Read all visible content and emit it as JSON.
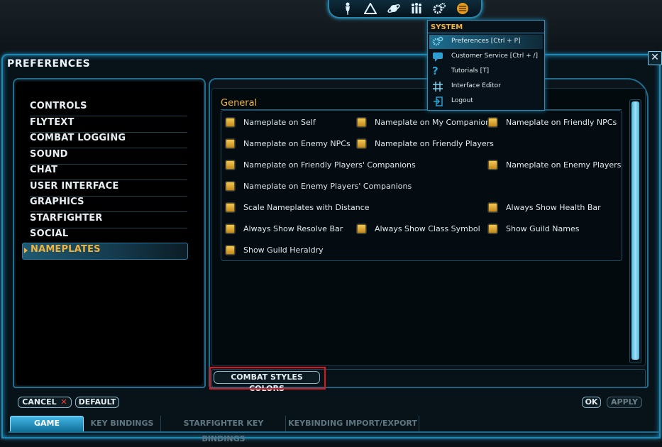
{
  "window": {
    "title": "PREFERENCES",
    "close_label": "✕"
  },
  "topbar": {
    "icons": [
      "character-icon",
      "abilities-icon",
      "galaxy-map-icon",
      "social-icon",
      "system-gear-icon",
      "credits-icon"
    ]
  },
  "system_menu": {
    "header": "SYSTEM",
    "items": [
      {
        "label": "Preferences [Ctrl + P]",
        "icon": "gear-icon"
      },
      {
        "label": "Customer Service [Ctrl + /]",
        "icon": "chat-bubble-icon"
      },
      {
        "label": "Tutorials [T]",
        "icon": "question-icon"
      },
      {
        "label": "Interface Editor",
        "icon": "grid-icon"
      },
      {
        "label": "Logout",
        "icon": "logout-icon"
      }
    ]
  },
  "sidebar": {
    "items": [
      {
        "label": "CONTROLS"
      },
      {
        "label": "FLYTEXT"
      },
      {
        "label": "COMBAT LOGGING"
      },
      {
        "label": "SOUND"
      },
      {
        "label": "CHAT"
      },
      {
        "label": "USER INTERFACE"
      },
      {
        "label": "GRAPHICS"
      },
      {
        "label": "STARFIGHTER"
      },
      {
        "label": "SOCIAL"
      },
      {
        "label": "NAMEPLATES"
      }
    ],
    "active": "NAMEPLATES"
  },
  "general": {
    "title": "General",
    "options": [
      {
        "label": "Nameplate on Self",
        "checked": true
      },
      {
        "label": "Nameplate on My Companion",
        "checked": true
      },
      {
        "label": "Nameplate on Friendly NPCs",
        "checked": true
      },
      {
        "label": "Nameplate on Enemy NPCs",
        "checked": true
      },
      {
        "label": "Nameplate on Friendly Players",
        "checked": true
      },
      {
        "label": "Nameplate on Friendly Players' Companions",
        "checked": true
      },
      {
        "label": "Nameplate on Enemy Players",
        "checked": true
      },
      {
        "label": "Nameplate on Enemy Players' Companions",
        "checked": true
      },
      {
        "label": "Scale Nameplates with Distance",
        "checked": true
      },
      {
        "label": "Always Show Health Bar",
        "checked": true
      },
      {
        "label": "Always Show Resolve Bar",
        "checked": true
      },
      {
        "label": "Always Show Class Symbol",
        "checked": true
      },
      {
        "label": "Show Guild Names",
        "checked": true
      },
      {
        "label": "Show Guild Heraldry",
        "checked": true
      }
    ]
  },
  "buttons": {
    "combat_styles_colors": "COMBAT STYLES COLORS",
    "cancel": "CANCEL",
    "cancel_icon": "✕",
    "default": "DEFAULT",
    "ok": "OK",
    "apply": "APPLY"
  },
  "tabs": [
    {
      "label": "GAME",
      "active": true
    },
    {
      "label": "KEY BINDINGS",
      "active": false
    },
    {
      "label": "STARFIGHTER KEY BINDINGS",
      "active": false
    },
    {
      "label": "KEYBINDING IMPORT/EXPORT",
      "active": false
    }
  ],
  "colors": {
    "accent": "#2389b0",
    "highlight": "#f0b23c",
    "checkbox": "#e3ad3a",
    "annotation": "#e0141a"
  }
}
